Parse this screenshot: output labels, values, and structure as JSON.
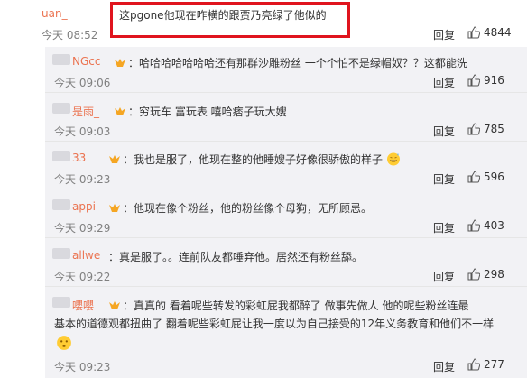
{
  "top": {
    "username": "uan_",
    "text": "这pgone他现在咋横的跟贾乃亮绿了他似的",
    "time": "今天 08:52",
    "reply_label": "回复",
    "likes": "4844"
  },
  "replies": [
    {
      "username": "NGcc",
      "text": "哈哈哈哈哈哈哈还有那群沙雕粉丝    一个个怕不是绿帽奴？？这都能洗",
      "time": "今天 09:06",
      "reply_label": "回复",
      "likes": "916"
    },
    {
      "username": "是雨_",
      "text": "穷玩车 富玩表 嘻哈痞子玩大嫂",
      "time": "今天 09:03",
      "reply_label": "回复",
      "likes": "785"
    },
    {
      "username": "33",
      "text": "我也是服了，他现在整的他睡嫂子好像很骄傲的样子",
      "time": "今天 09:23",
      "reply_label": "回复",
      "likes": "596"
    },
    {
      "username": "appi",
      "text": "他现在像个粉丝，他的粉丝像个母狗，无所顾忌。",
      "time": "今天 09:29",
      "reply_label": "回复",
      "likes": "403"
    },
    {
      "username": "allwe",
      "text": "真是服了。。连前队友都唾弃他。居然还有粉丝舔。",
      "time": "今天 09:22",
      "reply_label": "回复",
      "likes": "298"
    },
    {
      "username": "嚶嚶",
      "text": "真真的  看着呢些转发的彩虹屁我都醉了 做事先做人 他的呢些粉丝连最",
      "text2": "基本的道德观都扭曲了  翻着呢些彩虹屁让我一度以为自己接受的12年义务教育和他们不一样",
      "time": "今天 09:23",
      "reply_label": "回复",
      "likes": "277"
    }
  ],
  "colors": {
    "username": "#eb7350",
    "text": "#333333",
    "meta": "#808080",
    "highlight": "#e0141e",
    "reply_bg": "#f2f2f5"
  }
}
